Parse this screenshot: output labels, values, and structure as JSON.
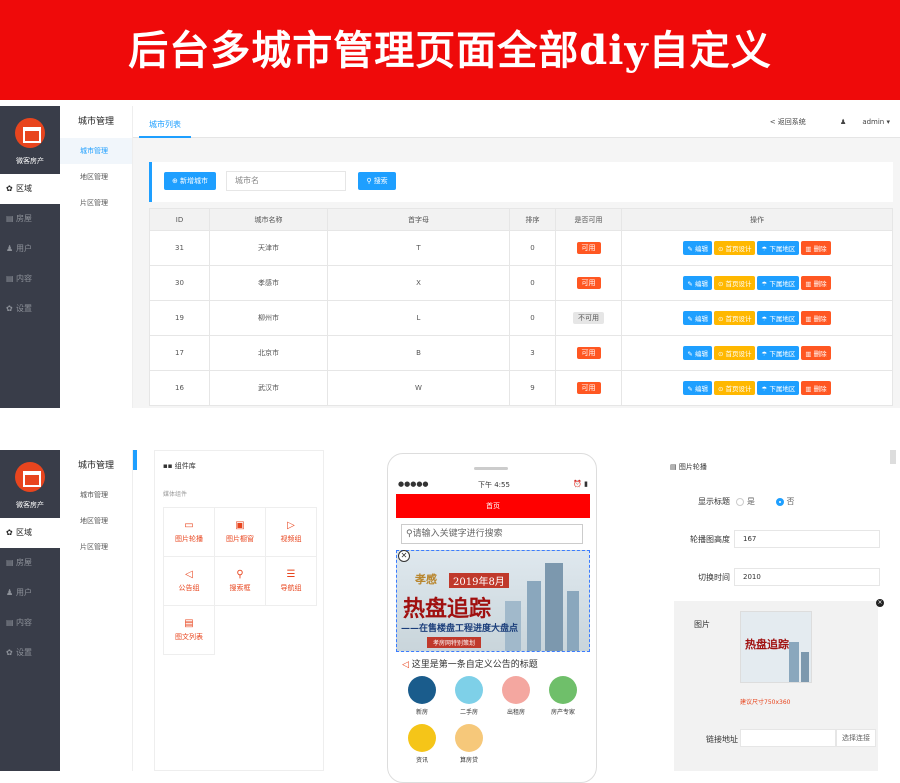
{
  "banner": {
    "title": "后台多城市管理页面全部diy自定义"
  },
  "sidebar": {
    "brand": "微客房产",
    "items": [
      {
        "icon": "gear-icon",
        "label": "区域",
        "active": true
      },
      {
        "icon": "building-icon",
        "label": "房屋"
      },
      {
        "icon": "user-icon",
        "label": "用户"
      },
      {
        "icon": "doc-icon",
        "label": "内容"
      },
      {
        "icon": "gear-icon",
        "label": "设置"
      }
    ]
  },
  "submenu": {
    "title": "城市管理",
    "items": [
      "城市管理",
      "地区管理",
      "片区管理"
    ]
  },
  "top": {
    "tab": "城市列表",
    "back": "< 返回系统",
    "user": "admin"
  },
  "filter": {
    "add_label": "新增城市",
    "search_placeholder": "城市名",
    "search_label": "搜索"
  },
  "table": {
    "headers": [
      "ID",
      "城市名称",
      "首字母",
      "排序",
      "是否可用",
      "操作"
    ],
    "rows": [
      {
        "id": "31",
        "name": "天津市",
        "letter": "T",
        "sort": "0",
        "status": "可用",
        "on": true
      },
      {
        "id": "30",
        "name": "孝感市",
        "letter": "X",
        "sort": "0",
        "status": "可用",
        "on": true
      },
      {
        "id": "19",
        "name": "柳州市",
        "letter": "L",
        "sort": "0",
        "status": "不可用",
        "on": false
      },
      {
        "id": "17",
        "name": "北京市",
        "letter": "B",
        "sort": "3",
        "status": "可用",
        "on": true
      },
      {
        "id": "16",
        "name": "武汉市",
        "letter": "W",
        "sort": "9",
        "status": "可用",
        "on": true
      }
    ],
    "ops": [
      "编辑",
      "首页设计",
      "下属地区",
      "删除"
    ]
  },
  "components": {
    "title": "组件库",
    "section": "媒体组件",
    "items": [
      {
        "label": "图片轮播",
        "icon": "image-slider-icon"
      },
      {
        "label": "图片橱窗",
        "icon": "image-window-icon"
      },
      {
        "label": "视频组",
        "icon": "video-icon"
      },
      {
        "label": "公告组",
        "icon": "megaphone-icon"
      },
      {
        "label": "搜索框",
        "icon": "search-icon"
      },
      {
        "label": "导航组",
        "icon": "list-icon"
      },
      {
        "label": "图文列表",
        "icon": "article-icon"
      }
    ]
  },
  "phone": {
    "carrier": "●●●●●",
    "time": "下午 4:55",
    "header": "首页",
    "search_placeholder": "请输入关键字进行搜索",
    "banner_text1": "孝感",
    "banner_text2": "2019年8月",
    "banner_big": "热盘追踪",
    "banner_sub": "——在售楼盘工程进度大盘点",
    "banner_tag": "孝房网特别策划",
    "notice": "这里是第一条自定义公告的标题",
    "nav": [
      "新房",
      "二手房",
      "出租房",
      "房产专家",
      "资讯",
      "算房贷"
    ]
  },
  "settings": {
    "title": "图片轮播",
    "show_title_label": "显示标题",
    "yes": "是",
    "no": "否",
    "height_label": "轮播图高度",
    "height_value": "167",
    "interval_label": "切换时间",
    "interval_value": "2010",
    "image_label": "图片",
    "thumb_big": "热盘追踪",
    "hint": "建议尺寸750x360",
    "link_label": "链接地址",
    "link_button": "选择连接"
  }
}
